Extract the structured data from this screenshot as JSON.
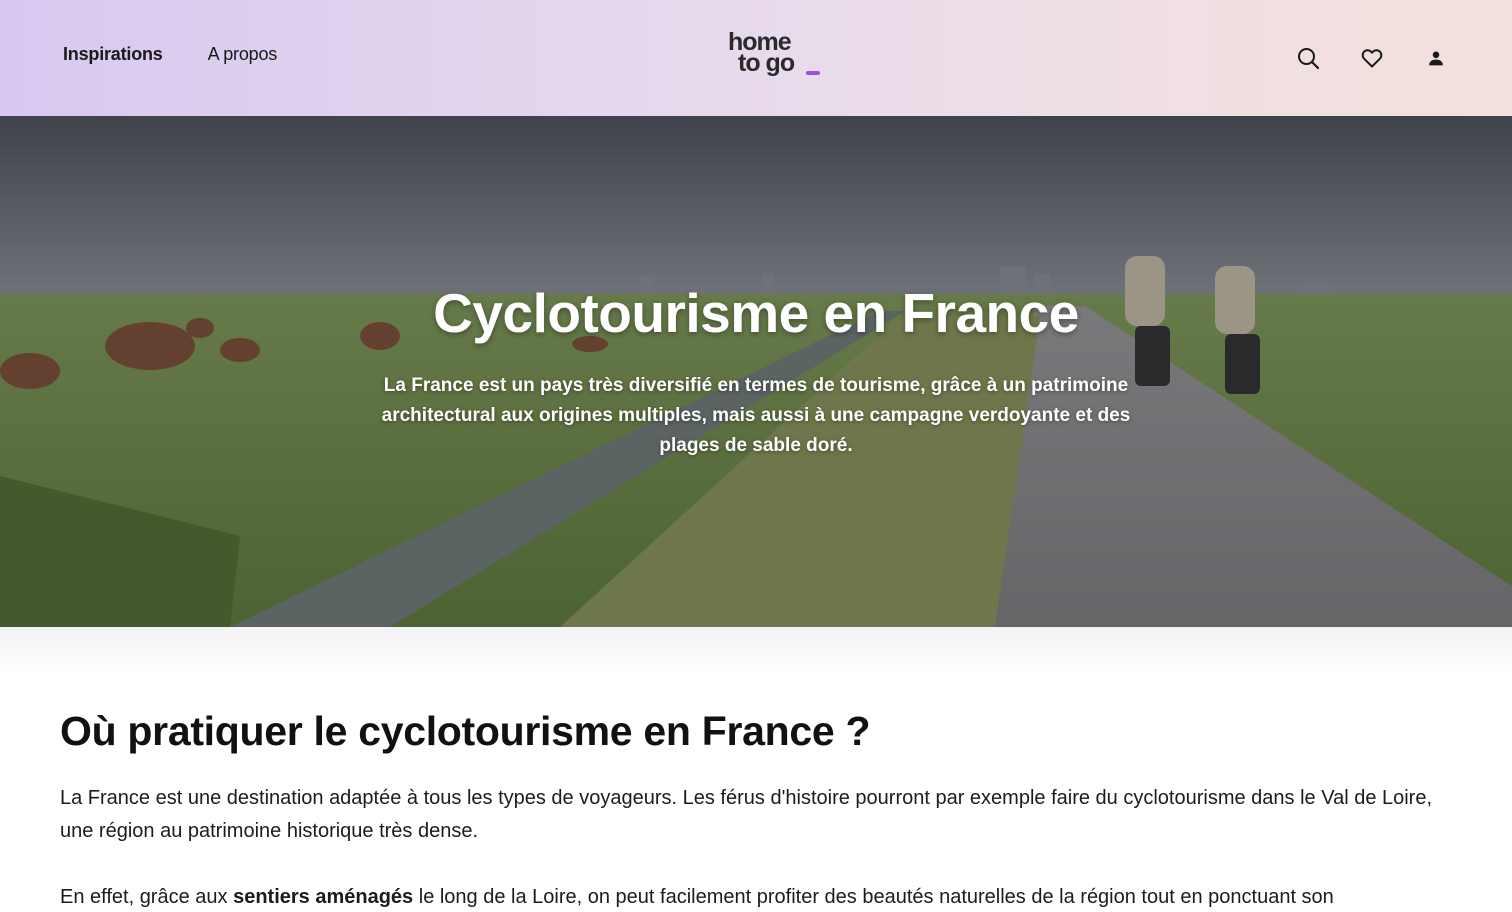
{
  "header": {
    "nav": [
      {
        "label": "Inspirations",
        "active": true
      },
      {
        "label": "A propos",
        "active": false
      }
    ],
    "logo": {
      "line1": "home",
      "line2": "to go",
      "accent_color": "#9b4fd6"
    },
    "actions": [
      {
        "icon": "search-icon"
      },
      {
        "icon": "heart-icon"
      },
      {
        "icon": "user-icon"
      }
    ]
  },
  "hero": {
    "title": "Cyclotourisme en France",
    "subtitle": "La France est un pays très diversifié en termes de tourisme, grâce à un patrimoine architectural aux origines multiples, mais aussi à une campagne verdoyante et des plages de sable doré."
  },
  "section": {
    "title": "Où pratiquer le cyclotourisme en France ?",
    "paragraph1": "La France est une destination adaptée à tous les types de voyageurs. Les férus d'histoire pourront par exemple faire du cyclotourisme dans le Val de Loire, une région au patrimoine historique très dense.",
    "paragraph2_pre": "En effet, grâce aux ",
    "paragraph2_bold": "sentiers aménagés",
    "paragraph2_post": " le long de la Loire, on peut facilement profiter des beautés naturelles de la région tout en ponctuant son"
  }
}
